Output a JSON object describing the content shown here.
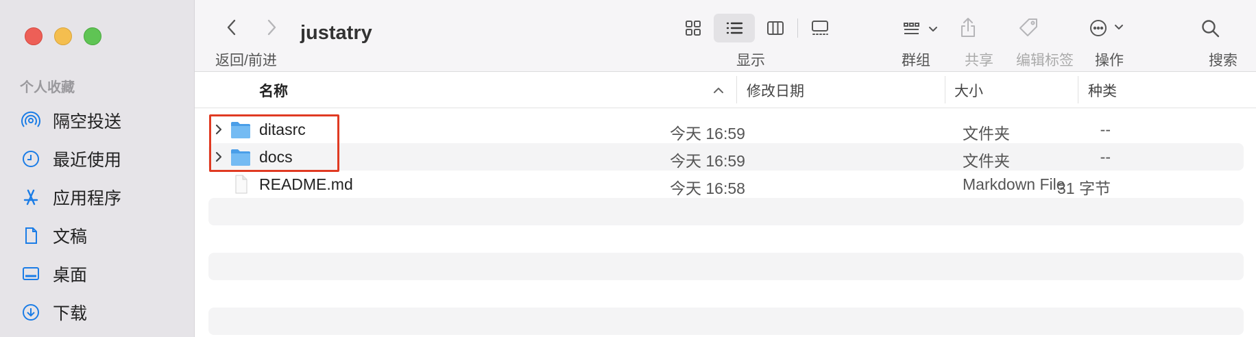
{
  "window": {
    "title": "justatry"
  },
  "sidebar": {
    "section": "个人收藏",
    "items": [
      {
        "label": "隔空投送",
        "icon": "airdrop-icon"
      },
      {
        "label": "最近使用",
        "icon": "clock-icon"
      },
      {
        "label": "应用程序",
        "icon": "applications-icon"
      },
      {
        "label": "文稿",
        "icon": "document-icon"
      },
      {
        "label": "桌面",
        "icon": "desktop-icon"
      },
      {
        "label": "下载",
        "icon": "download-icon"
      }
    ]
  },
  "toolbar": {
    "nav_label": "返回/前进",
    "view_label": "显示",
    "group_label": "群组",
    "share_label": "共享",
    "tags_label": "编辑标签",
    "action_label": "操作",
    "search_label": "搜索"
  },
  "columns": {
    "name": "名称",
    "modified": "修改日期",
    "size": "大小",
    "kind": "种类"
  },
  "files": [
    {
      "name": "ditasrc",
      "date": "今天 16:59",
      "size": "--",
      "kind": "文件夹",
      "type": "folder"
    },
    {
      "name": "docs",
      "date": "今天 16:59",
      "size": "--",
      "kind": "文件夹",
      "type": "folder"
    },
    {
      "name": "README.md",
      "date": "今天 16:58",
      "size": "31 字节",
      "kind": "Markdown File",
      "type": "file"
    }
  ],
  "colors": {
    "accent": "#1a7ce6",
    "highlight_box": "#e03a22",
    "folder": "#5aaef0"
  }
}
